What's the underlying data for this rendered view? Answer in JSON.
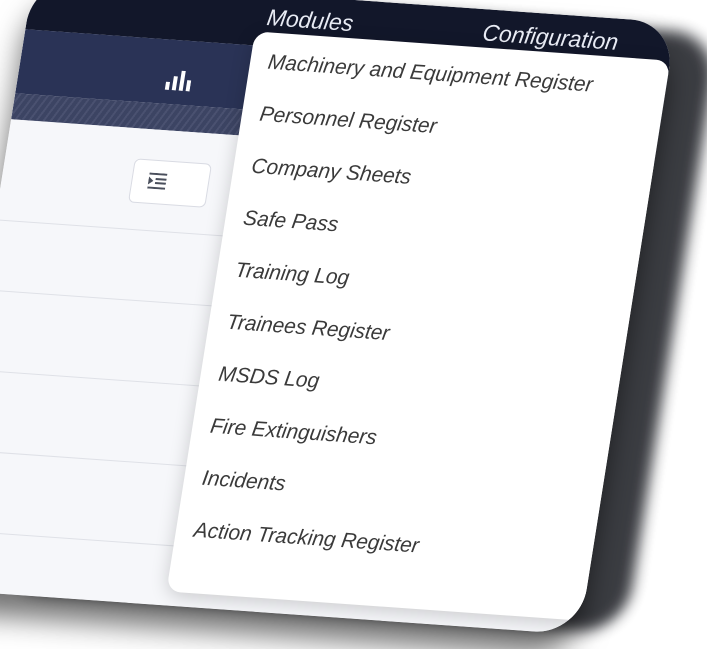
{
  "nav": {
    "modules_label": "Modules",
    "configuration_label": "Configuration"
  },
  "menu": {
    "items": [
      {
        "label": "Machinery and Equipment Register"
      },
      {
        "label": "Personnel Register"
      },
      {
        "label": "Company Sheets"
      },
      {
        "label": "Safe Pass"
      },
      {
        "label": "Training Log"
      },
      {
        "label": "Trainees Register"
      },
      {
        "label": "MSDS Log"
      },
      {
        "label": "Fire Extinguishers"
      },
      {
        "label": "Incidents"
      },
      {
        "label": "Action Tracking Register"
      }
    ]
  },
  "icons": {
    "brand": "bar-chart-icon",
    "toolbar": "indent-icon"
  },
  "colors": {
    "topnav": "#12172a",
    "brandbar": "#2a3356",
    "menu_bg": "#ffffff",
    "menu_text": "#3a3a3a"
  }
}
